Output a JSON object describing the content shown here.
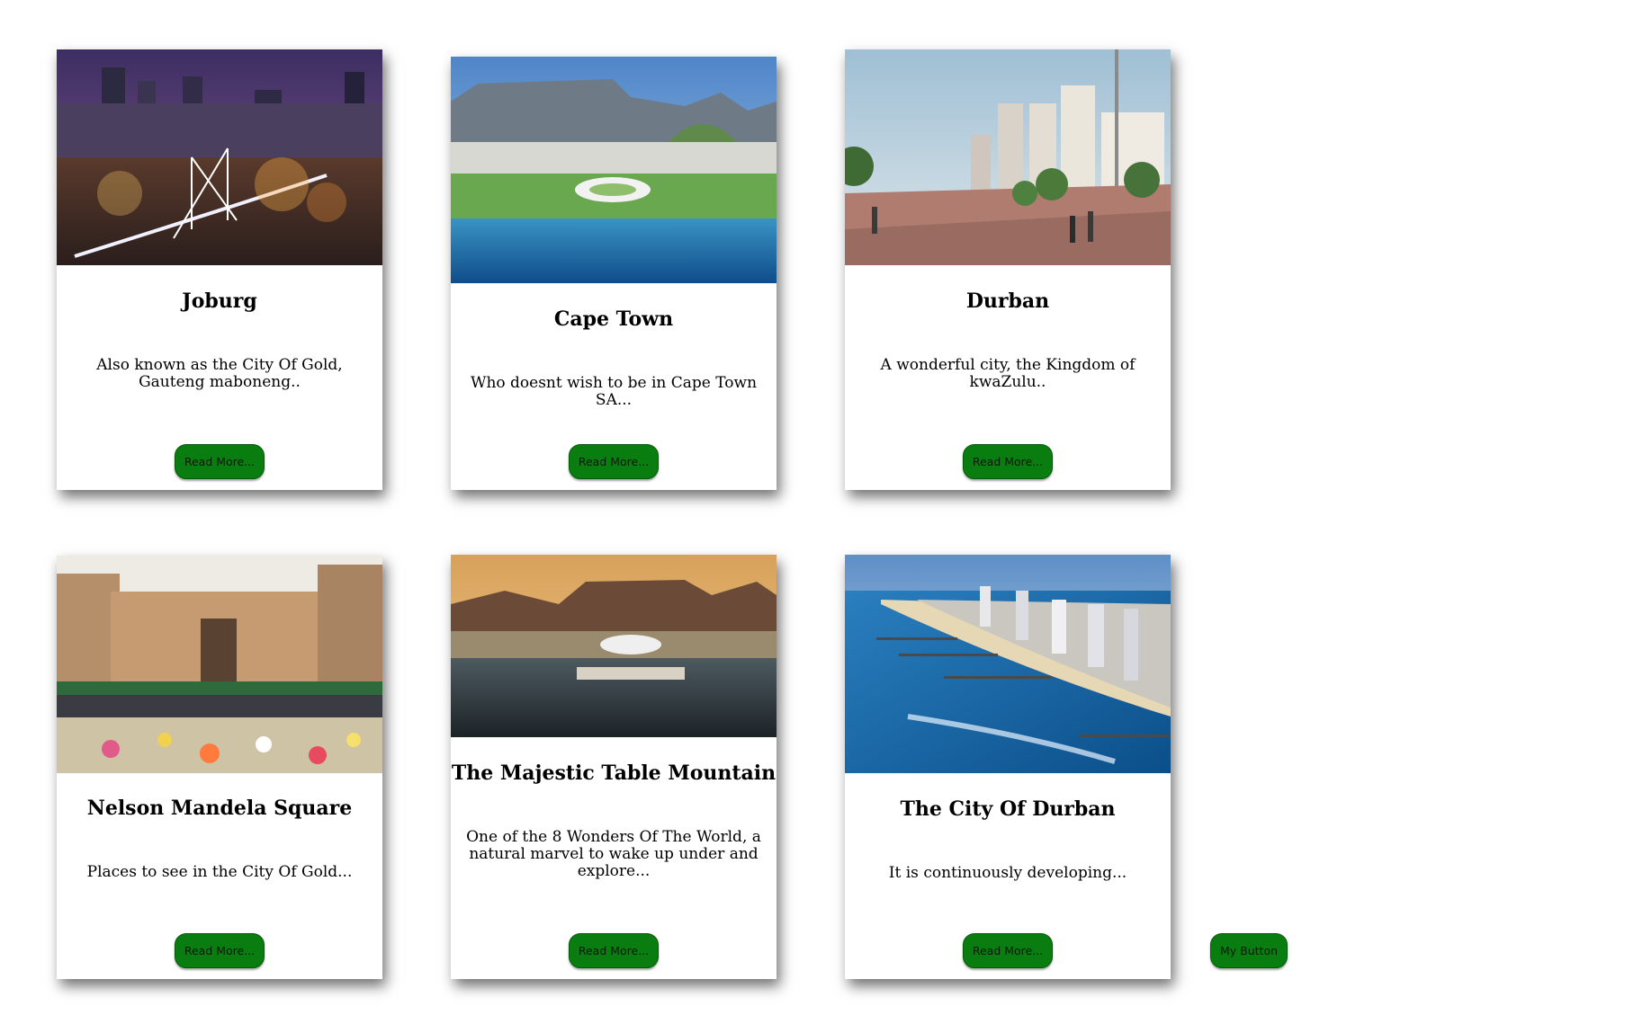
{
  "cards": [
    {
      "title": "Joburg",
      "description": "Also known as the City Of Gold, Gauteng maboneng..",
      "button": "Read More...",
      "image": "joburg-night-skyline"
    },
    {
      "title": "Cape Town",
      "description": "Who doesnt wish to be in Cape Town SA...",
      "button": "Read More...",
      "image": "cape-town-table-mountain-stadium"
    },
    {
      "title": "Durban",
      "description": "A wonderful city, the Kingdom of kwaZulu..",
      "button": "Read More...",
      "image": "durban-beachfront-promenade"
    },
    {
      "title": "Nelson Mandela Square",
      "description": "Places to see in the City Of Gold...",
      "button": "Read More...",
      "image": "nelson-mandela-square-flowers"
    },
    {
      "title": "The Majestic Table Mountain",
      "description": "One of the 8 Wonders Of The World, a natural marvel to wake up under and explore...",
      "button": "Read More...",
      "image": "table-mountain-sunset"
    },
    {
      "title": "The City Of Durban",
      "description": "It is continuously developing...",
      "button": "Read More...",
      "image": "durban-coastline-aerial"
    }
  ],
  "extra_button": "My Button",
  "colors": {
    "button_bg": "#0a7d10",
    "card_bg": "#ffffff",
    "page_bg": "#ffffff"
  }
}
